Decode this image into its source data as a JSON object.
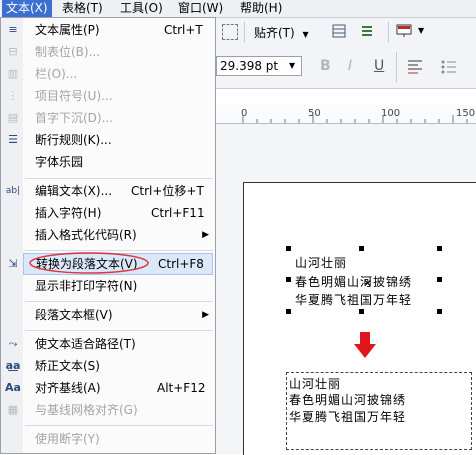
{
  "menubar": {
    "items": [
      {
        "label": "文本(X)",
        "active": true
      },
      {
        "label": "表格(T)",
        "active": false
      },
      {
        "label": "工具(O)",
        "active": false
      },
      {
        "label": "窗口(W)",
        "active": false
      },
      {
        "label": "帮助(H)",
        "active": false
      }
    ]
  },
  "toolbar": {
    "snap_label": "贴齐(T)",
    "size_value": "29.398 pt"
  },
  "ruler": {
    "ticks": [
      "0",
      "50",
      "100",
      "150"
    ]
  },
  "menu": {
    "items": [
      {
        "label": "文本属性(P)",
        "shortcut": "Ctrl+T",
        "disabled": false
      },
      {
        "label": "制表位(B)...",
        "shortcut": "",
        "disabled": true
      },
      {
        "label": "栏(O)...",
        "shortcut": "",
        "disabled": true
      },
      {
        "label": "项目符号(U)...",
        "shortcut": "",
        "disabled": true
      },
      {
        "label": "首字下沉(D)...",
        "shortcut": "",
        "disabled": true
      },
      {
        "label": "断行规则(K)...",
        "shortcut": "",
        "disabled": false
      },
      {
        "label": "字体乐园",
        "shortcut": "",
        "disabled": false
      },
      {
        "label": "编辑文本(X)...",
        "shortcut": "Ctrl+位移+T",
        "disabled": false
      },
      {
        "label": "插入字符(H)",
        "shortcut": "Ctrl+F11",
        "disabled": false
      },
      {
        "label": "插入格式化代码(R)",
        "shortcut": "",
        "disabled": false
      },
      {
        "label": "转换为段落文本(V)",
        "shortcut": "Ctrl+F8",
        "disabled": false
      },
      {
        "label": "显示非打印字符(N)",
        "shortcut": "",
        "disabled": false
      },
      {
        "label": "段落文本框(V)",
        "shortcut": "",
        "disabled": false
      },
      {
        "label": "使文本适合路径(T)",
        "shortcut": "",
        "disabled": false
      },
      {
        "label": "矫正文本(S)",
        "shortcut": "",
        "disabled": false
      },
      {
        "label": "对齐基线(A)",
        "shortcut": "Alt+F12",
        "disabled": false
      },
      {
        "label": "与基线网格对齐(G)",
        "shortcut": "",
        "disabled": true
      },
      {
        "label": "使用断字(Y)",
        "shortcut": "",
        "disabled": true
      }
    ]
  },
  "canvas": {
    "art_text": {
      "line1": "山河壮丽",
      "line2": "春色明媚山河披锦绣",
      "line3": "华夏腾飞祖国万年轻"
    },
    "para_text": {
      "line1": "山河壮丽",
      "line2": "春色明媚山河披锦绣",
      "line3": "华夏腾飞祖国万年轻"
    }
  },
  "colors": {
    "accent": "#3c6fd0",
    "highlight": "#dbe8fa",
    "arrow": "#e0151b",
    "circle": "#d9363e"
  }
}
